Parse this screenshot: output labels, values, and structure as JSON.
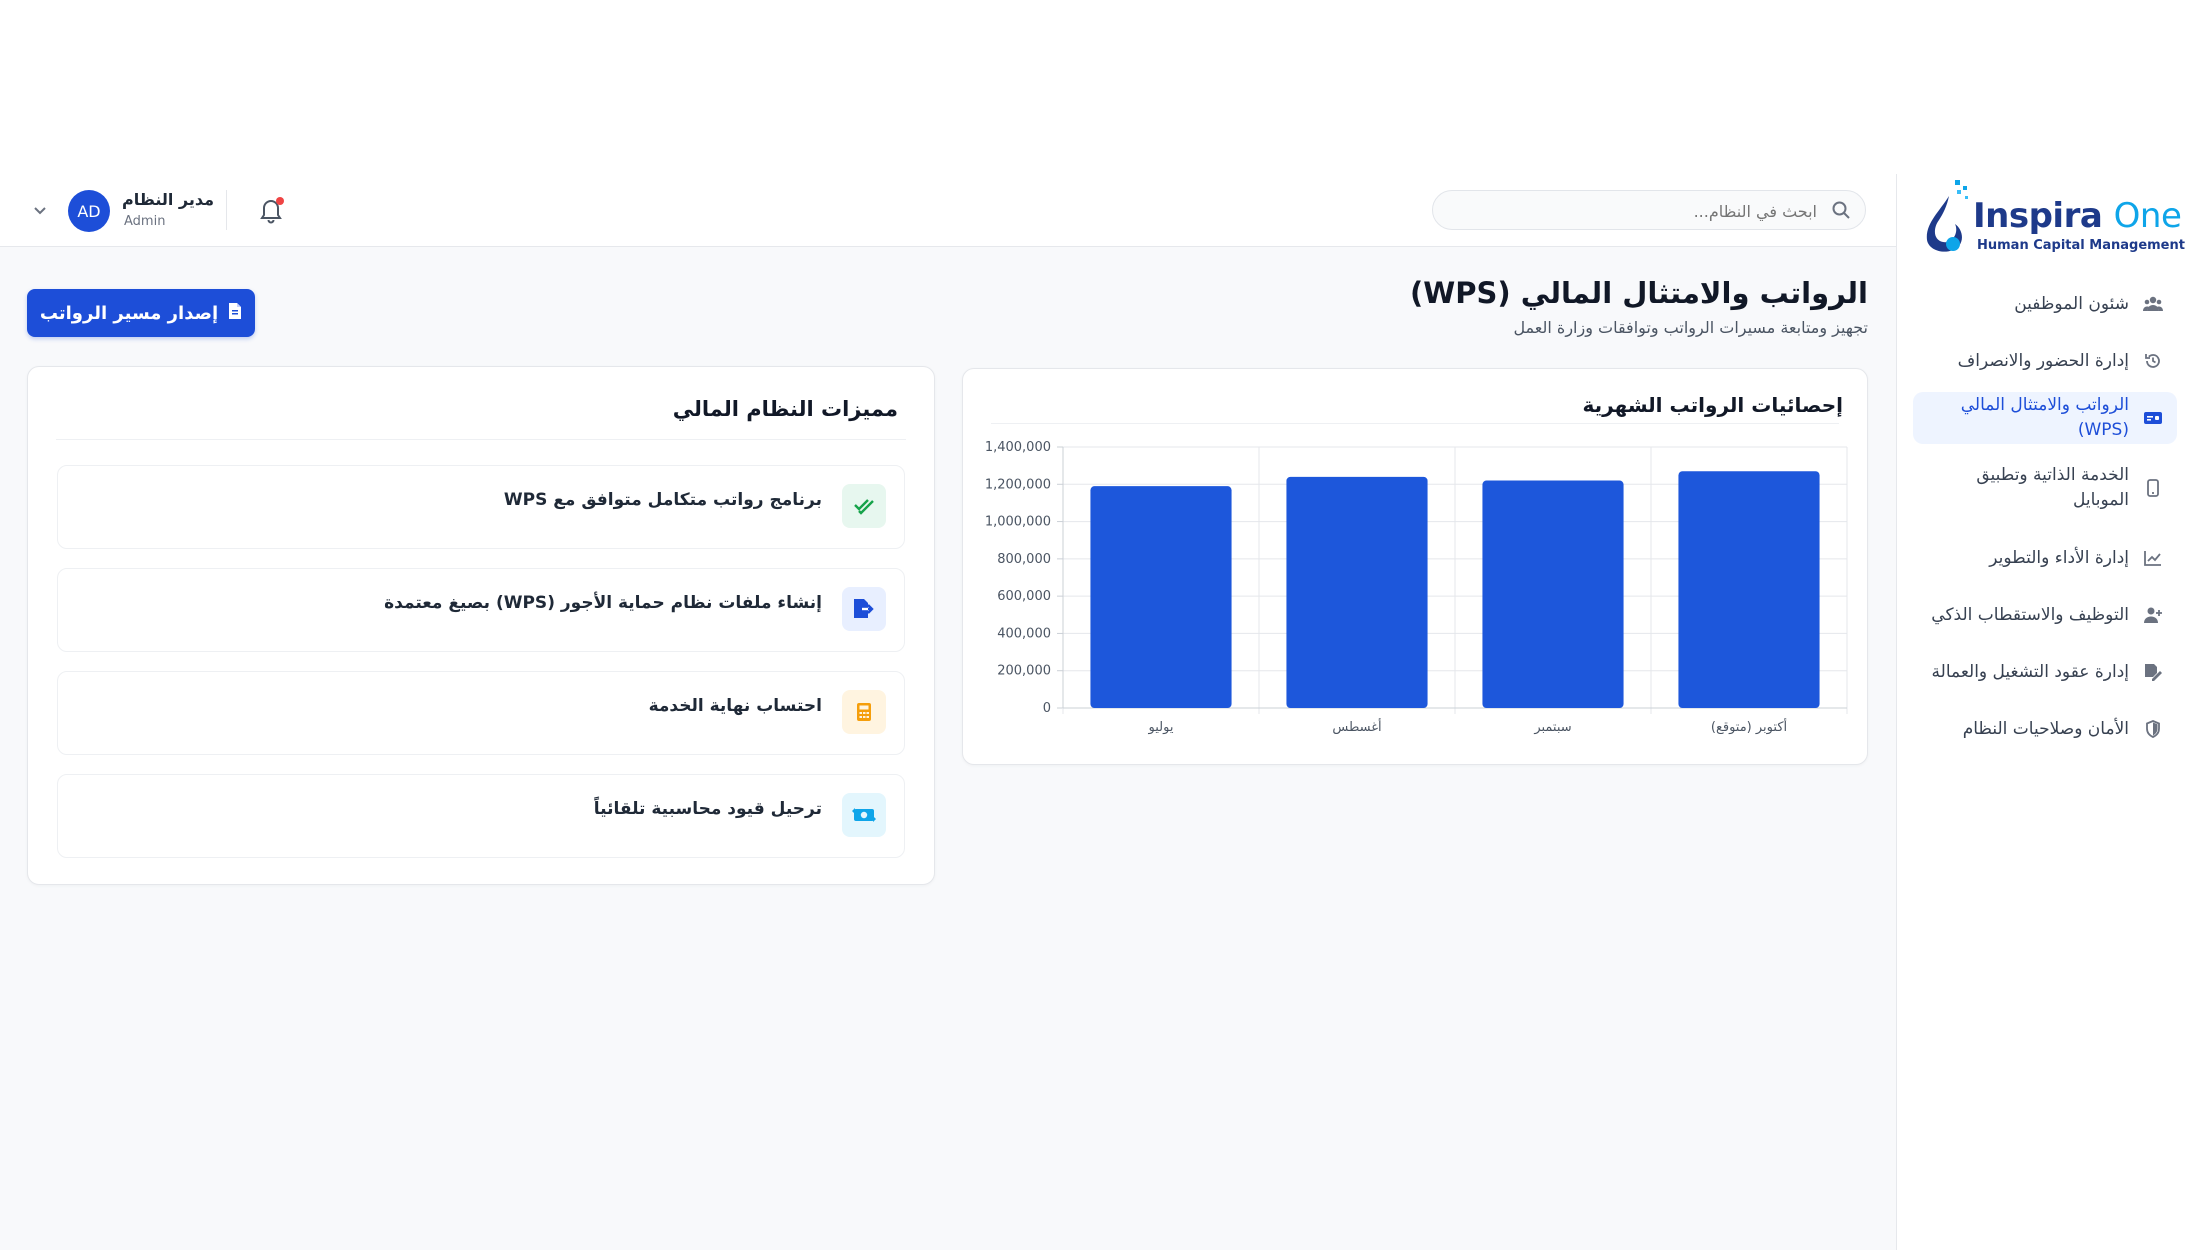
{
  "app": {
    "logo_text_main": "Inspira",
    "logo_text_accent": "One",
    "logo_subtitle": "Human Capital Management"
  },
  "sidebar": {
    "items": [
      {
        "label": "شئون الموظفين",
        "icon": "users-icon",
        "active": false
      },
      {
        "label": "إدارة الحضور والانصراف",
        "icon": "history-icon",
        "active": false
      },
      {
        "label": "الرواتب والامتثال المالي (WPS)",
        "icon": "money-card-icon",
        "active": true
      },
      {
        "label": "الخدمة الذاتية وتطبيق الموبايل",
        "icon": "mobile-icon",
        "active": false
      },
      {
        "label": "إدارة الأداء والتطوير",
        "icon": "chart-line-icon",
        "active": false
      },
      {
        "label": "التوظيف والاستقطاب الذكي",
        "icon": "user-plus-icon",
        "active": false
      },
      {
        "label": "إدارة عقود التشغيل والعمالة",
        "icon": "file-signature-icon",
        "active": false
      },
      {
        "label": "الأمان وصلاحيات النظام",
        "icon": "shield-icon",
        "active": false
      }
    ]
  },
  "header": {
    "search_placeholder": "ابحث في النظام...",
    "user_name": "مدير النظام",
    "user_role": "Admin",
    "avatar_initials": "AD"
  },
  "page": {
    "title": "الرواتب والامتثال المالي (WPS)",
    "subtitle": "تجهيز ومتابعة مسيرات الرواتب وتوافقات وزارة العمل",
    "primary_button": "إصدار مسير الرواتب"
  },
  "chart_card": {
    "title": "إحصائيات الرواتب الشهرية"
  },
  "chart_data": {
    "type": "bar",
    "title": "إحصائيات الرواتب الشهرية",
    "categories": [
      "يوليو",
      "أغسطس",
      "سبتمبر",
      "أكتوبر (متوقع)"
    ],
    "values": [
      1190000,
      1240000,
      1220000,
      1270000
    ],
    "ylim": [
      0,
      1400000
    ],
    "yticks": [
      0,
      200000,
      400000,
      600000,
      800000,
      1000000,
      1200000,
      1400000
    ],
    "ytick_labels": [
      "0",
      "200,000",
      "400,000",
      "600,000",
      "800,000",
      "1,000,000",
      "1,200,000",
      "1,400,000"
    ],
    "bar_color": "#1d57db",
    "grid": true,
    "xlabel": "",
    "ylabel": ""
  },
  "features": {
    "title": "مميزات النظام المالي",
    "items": [
      {
        "text": "برنامج رواتب متكامل متوافق مع WPS",
        "icon": "check-double-icon",
        "bg": "#e7f7ef",
        "color": "#16a34a"
      },
      {
        "text": "إنشاء ملفات نظام حماية الأجور (WPS) بصيغ معتمدة",
        "icon": "file-export-icon",
        "bg": "#e8efff",
        "color": "#1d4ed8"
      },
      {
        "text": "احتساب نهاية الخدمة",
        "icon": "calculator-icon",
        "bg": "#fff4e0",
        "color": "#f59e0b"
      },
      {
        "text": "ترحيل قيود محاسبية تلقائياً",
        "icon": "money-bill-transfer-icon",
        "bg": "#e3f6fd",
        "color": "#0ea5e9"
      }
    ]
  }
}
